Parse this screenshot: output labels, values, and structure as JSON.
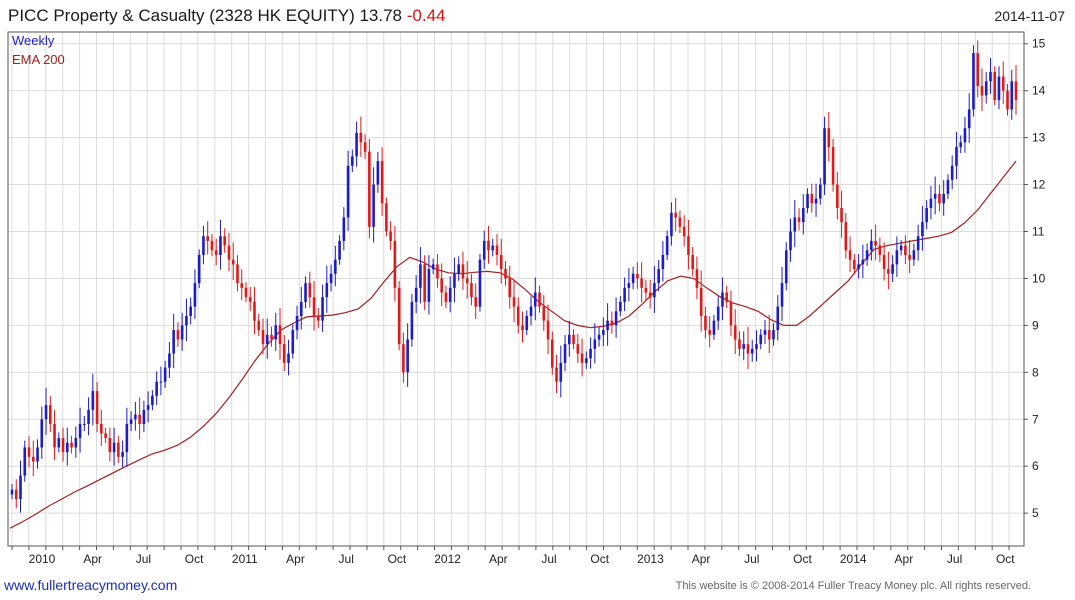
{
  "header": {
    "title": "PICC Property & Casualty (2328 HK EQUITY) 13.78",
    "change": "-0.44",
    "date": "2014-11-07"
  },
  "footer": {
    "link": "www.fullertreacymoney.com",
    "copyright": "This website is © 2008-2014 Fuller Treacy Money plc. All rights reserved."
  },
  "chart_data": {
    "type": "candlestick",
    "legend": [
      "Weekly",
      "EMA 200"
    ],
    "colors": {
      "up": "#1c1cc8",
      "down": "#e01a1a",
      "ema": "#a02020",
      "grid": "#dcdcdc"
    },
    "x_tick_labels": [
      "2010",
      "Apr",
      "Jul",
      "Oct",
      "2011",
      "Apr",
      "Jul",
      "Oct",
      "2012",
      "Apr",
      "Jul",
      "Oct",
      "2013",
      "Apr",
      "Jul",
      "Oct",
      "2014",
      "Apr",
      "Jul",
      "Oct"
    ],
    "y_tick_labels": [
      "5",
      "6",
      "7",
      "8",
      "9",
      "10",
      "11",
      "12",
      "13",
      "14",
      "15"
    ],
    "ylim": [
      4.3,
      15.25
    ],
    "weekly_close": [
      5.5,
      5.3,
      5.8,
      6.4,
      6.2,
      6.1,
      6.4,
      7.0,
      7.3,
      6.9,
      6.4,
      6.6,
      6.3,
      6.5,
      6.4,
      6.6,
      6.9,
      6.9,
      7.2,
      7.6,
      6.9,
      6.7,
      6.6,
      6.3,
      6.5,
      6.2,
      6.3,
      6.9,
      7.0,
      7.1,
      6.9,
      7.2,
      7.3,
      7.5,
      7.8,
      7.8,
      8.1,
      8.4,
      8.9,
      8.7,
      9.0,
      9.2,
      9.4,
      9.9,
      10.5,
      10.9,
      10.8,
      10.6,
      10.5,
      10.9,
      10.7,
      10.4,
      10.3,
      9.9,
      9.8,
      9.6,
      9.5,
      9.1,
      8.9,
      8.6,
      8.8,
      8.7,
      9.0,
      8.6,
      8.2,
      8.4,
      8.9,
      9.2,
      9.5,
      9.9,
      9.6,
      9.2,
      9.1,
      9.6,
      9.9,
      10.1,
      10.4,
      10.8,
      11.3,
      12.4,
      12.6,
      13.1,
      12.9,
      12.7,
      11.1,
      12.0,
      12.5,
      11.6,
      11.0,
      10.8,
      9.8,
      8.6,
      8.0,
      8.7,
      9.5,
      9.8,
      10.3,
      9.5,
      10.2,
      10.3,
      10.0,
      9.7,
      9.5,
      9.8,
      10.1,
      10.3,
      10.0,
      9.9,
      9.6,
      9.4,
      10.4,
      10.8,
      10.6,
      10.7,
      10.5,
      10.2,
      10.0,
      9.6,
      9.4,
      9.0,
      8.9,
      9.2,
      9.4,
      9.7,
      9.4,
      9.1,
      8.7,
      8.1,
      7.8,
      8.2,
      8.6,
      8.8,
      8.6,
      8.4,
      8.2,
      8.3,
      8.5,
      8.7,
      8.8,
      8.9,
      9.1,
      9.0,
      9.3,
      9.5,
      9.8,
      9.9,
      10.1,
      10.0,
      9.8,
      9.7,
      9.6,
      9.9,
      10.2,
      10.5,
      10.9,
      11.4,
      11.3,
      11.1,
      10.9,
      10.5,
      10.2,
      9.8,
      9.2,
      8.9,
      8.8,
      9.1,
      9.4,
      9.7,
      9.5,
      9.0,
      8.7,
      8.5,
      8.6,
      8.4,
      8.5,
      8.6,
      8.8,
      8.9,
      8.7,
      8.9,
      9.4,
      9.9,
      10.6,
      11.0,
      11.3,
      11.2,
      11.5,
      11.8,
      11.6,
      11.7,
      12.0,
      13.2,
      12.8,
      12.0,
      11.5,
      11.2,
      10.6,
      10.4,
      10.2,
      10.3,
      10.4,
      10.6,
      10.8,
      10.7,
      10.5,
      10.2,
      10.1,
      10.3,
      10.6,
      10.7,
      10.5,
      10.4,
      10.6,
      10.9,
      11.2,
      11.5,
      11.7,
      11.8,
      11.6,
      11.8,
      12.1,
      12.4,
      12.8,
      12.9,
      13.2,
      13.6,
      14.8,
      14.1,
      13.9,
      14.2,
      14.4,
      13.8,
      14.3,
      14.0,
      13.6,
      14.2,
      13.8
    ],
    "ema_200": [
      4.68,
      4.82,
      4.98,
      5.15,
      5.3,
      5.45,
      5.58,
      5.72,
      5.86,
      6.0,
      6.13,
      6.26,
      6.34,
      6.45,
      6.62,
      6.85,
      7.13,
      7.47,
      7.85,
      8.25,
      8.6,
      8.9,
      9.05,
      9.18,
      9.2,
      9.22,
      9.27,
      9.35,
      9.58,
      9.93,
      10.25,
      10.45,
      10.35,
      10.2,
      10.12,
      10.1,
      10.13,
      10.15,
      10.12,
      9.98,
      9.75,
      9.5,
      9.3,
      9.1,
      9.0,
      8.95,
      8.98,
      9.05,
      9.2,
      9.45,
      9.72,
      9.95,
      10.05,
      10.0,
      9.8,
      9.62,
      9.48,
      9.4,
      9.3,
      9.12,
      9.0,
      9.0,
      9.2,
      9.45,
      9.7,
      9.95,
      10.3,
      10.62,
      10.7,
      10.75,
      10.8,
      10.85,
      10.9,
      10.98,
      11.18,
      11.45,
      11.8,
      12.15,
      12.5
    ]
  }
}
